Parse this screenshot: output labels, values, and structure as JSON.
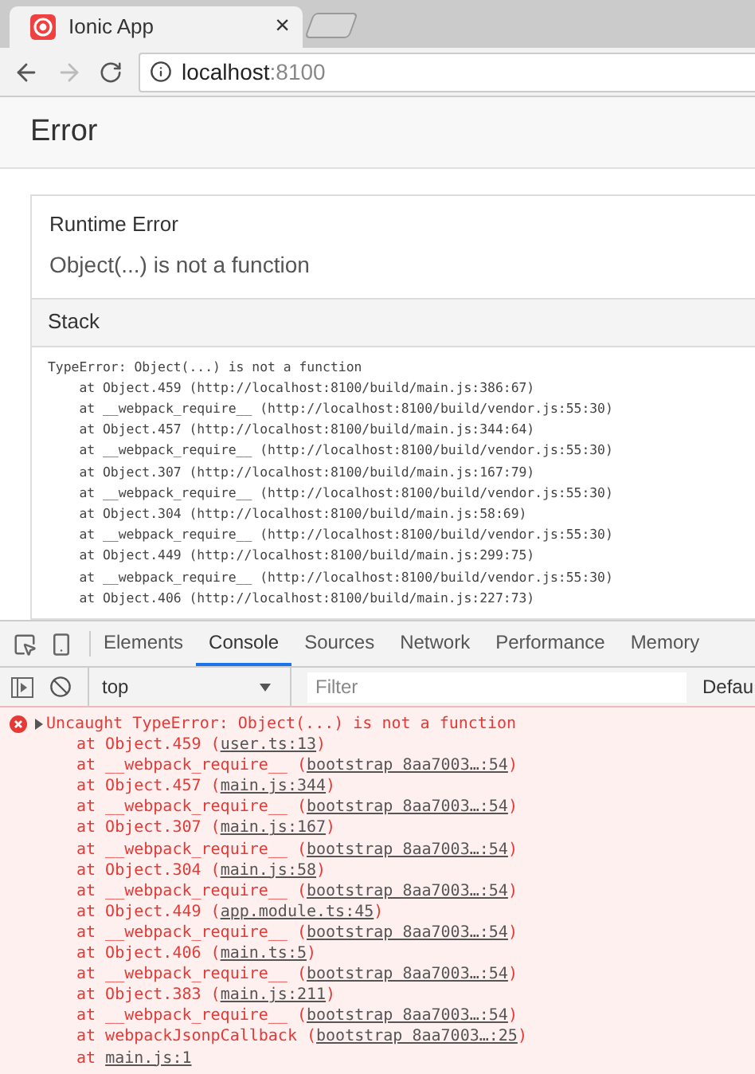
{
  "browser": {
    "tab": {
      "title": "Ionic App",
      "close": "×"
    },
    "address": {
      "host": "localhost",
      "port": ":8100"
    }
  },
  "page": {
    "header": "Error",
    "card": {
      "title": "Runtime Error",
      "message": "Object(...) is not a function",
      "stack_heading": "Stack",
      "stack": [
        "TypeError: Object(...) is not a function",
        "    at Object.459 (http://localhost:8100/build/main.js:386:67)",
        "    at __webpack_require__ (http://localhost:8100/build/vendor.js:55:30)",
        "    at Object.457 (http://localhost:8100/build/main.js:344:64)",
        "    at __webpack_require__ (http://localhost:8100/build/vendor.js:55:30)",
        "    at Object.307 (http://localhost:8100/build/main.js:167:79)",
        "    at __webpack_require__ (http://localhost:8100/build/vendor.js:55:30)",
        "    at Object.304 (http://localhost:8100/build/main.js:58:69)",
        "    at __webpack_require__ (http://localhost:8100/build/vendor.js:55:30)",
        "    at Object.449 (http://localhost:8100/build/main.js:299:75)",
        "    at __webpack_require__ (http://localhost:8100/build/vendor.js:55:30)",
        "    at Object.406 (http://localhost:8100/build/main.js:227:73)"
      ]
    }
  },
  "devtools": {
    "tabs": [
      {
        "label": "Elements",
        "selected": false
      },
      {
        "label": "Console",
        "selected": true
      },
      {
        "label": "Sources",
        "selected": false
      },
      {
        "label": "Network",
        "selected": false
      },
      {
        "label": "Performance",
        "selected": false
      },
      {
        "label": "Memory",
        "selected": false
      }
    ],
    "context": "top",
    "filter_placeholder": "Filter",
    "levels": "Defau",
    "error": {
      "message": "Uncaught TypeError: Object(...) is not a function",
      "frames": [
        {
          "prefix": "at Object.459 (",
          "link": "user.ts:13",
          "suffix": ")"
        },
        {
          "prefix": "at __webpack_require__ (",
          "link": "bootstrap 8aa7003…:54",
          "suffix": ")"
        },
        {
          "prefix": "at Object.457 (",
          "link": "main.js:344",
          "suffix": ")"
        },
        {
          "prefix": "at __webpack_require__ (",
          "link": "bootstrap 8aa7003…:54",
          "suffix": ")"
        },
        {
          "prefix": "at Object.307 (",
          "link": "main.js:167",
          "suffix": ")"
        },
        {
          "prefix": "at __webpack_require__ (",
          "link": "bootstrap 8aa7003…:54",
          "suffix": ")"
        },
        {
          "prefix": "at Object.304 (",
          "link": "main.js:58",
          "suffix": ")"
        },
        {
          "prefix": "at __webpack_require__ (",
          "link": "bootstrap 8aa7003…:54",
          "suffix": ")"
        },
        {
          "prefix": "at Object.449 (",
          "link": "app.module.ts:45",
          "suffix": ")"
        },
        {
          "prefix": "at __webpack_require__ (",
          "link": "bootstrap 8aa7003…:54",
          "suffix": ")"
        },
        {
          "prefix": "at Object.406 (",
          "link": "main.ts:5",
          "suffix": ")"
        },
        {
          "prefix": "at __webpack_require__ (",
          "link": "bootstrap 8aa7003…:54",
          "suffix": ")"
        },
        {
          "prefix": "at Object.383 (",
          "link": "main.js:211",
          "suffix": ")"
        },
        {
          "prefix": "at __webpack_require__ (",
          "link": "bootstrap 8aa7003…:54",
          "suffix": ")"
        },
        {
          "prefix": "at webpackJsonpCallback (",
          "link": "bootstrap 8aa7003…:25",
          "suffix": ")"
        },
        {
          "prefix": "at ",
          "link": "main.js:1"
        }
      ]
    }
  }
}
